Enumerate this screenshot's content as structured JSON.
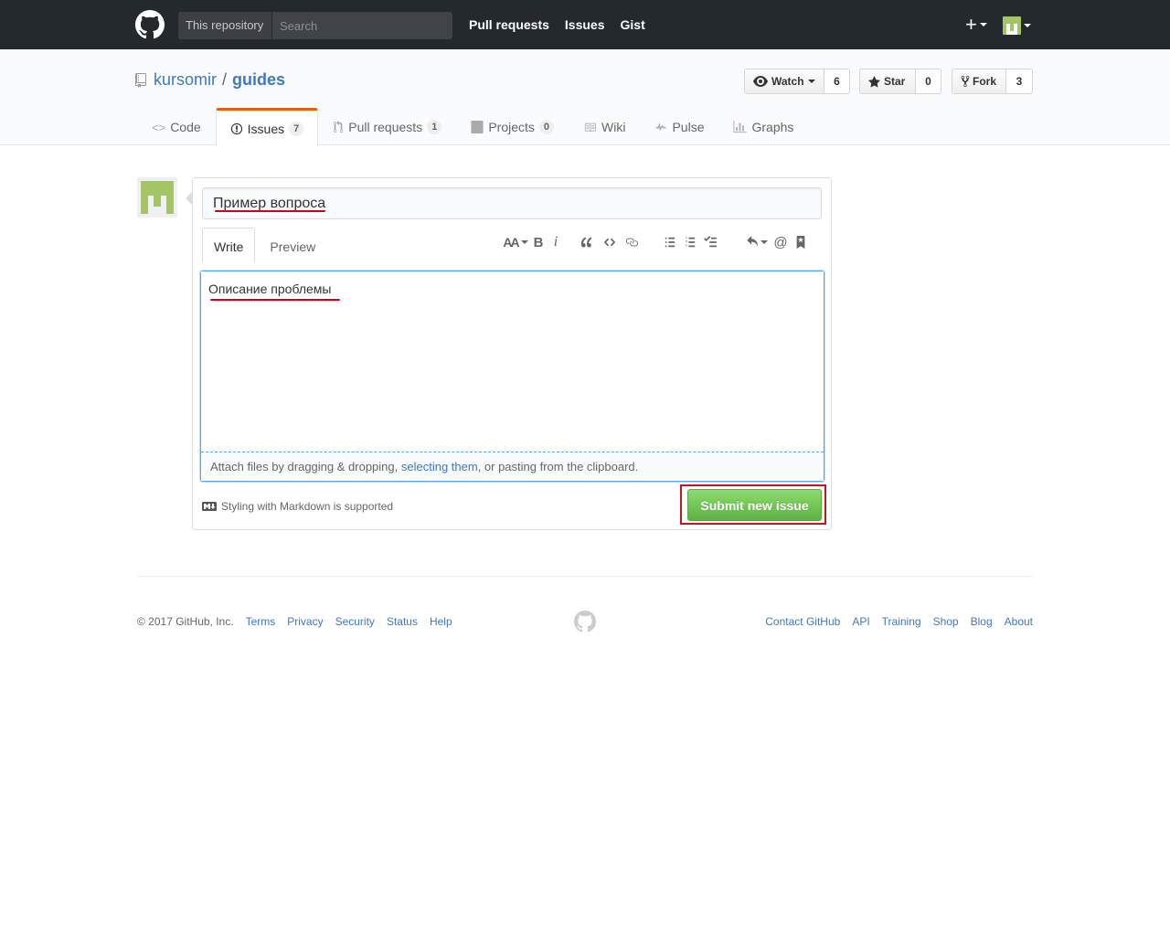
{
  "header": {
    "scope_label": "This repository",
    "search_placeholder": "Search",
    "nav": [
      "Pull requests",
      "Issues",
      "Gist"
    ],
    "plus_label": "+"
  },
  "repo": {
    "owner": "kursomir",
    "separator": "/",
    "name": "guides",
    "watch": {
      "label": "Watch",
      "count": "6"
    },
    "star": {
      "label": "Star",
      "count": "0"
    },
    "fork": {
      "label": "Fork",
      "count": "3"
    }
  },
  "reponav": {
    "code": {
      "label": "Code"
    },
    "issues": {
      "label": "Issues",
      "count": "7"
    },
    "pulls": {
      "label": "Pull requests",
      "count": "1"
    },
    "projects": {
      "label": "Projects",
      "count": "0"
    },
    "wiki": {
      "label": "Wiki"
    },
    "pulse": {
      "label": "Pulse"
    },
    "graphs": {
      "label": "Graphs"
    }
  },
  "form": {
    "title_value": "Пример вопроса",
    "write_tab": "Write",
    "preview_tab": "Preview",
    "body_value": "Описание проблемы",
    "attach_prefix": "Attach files by dragging & dropping, ",
    "attach_link": "selecting them",
    "attach_suffix": ", or pasting from the clipboard.",
    "markdown_hint": "Styling with Markdown is supported",
    "submit_label": "Submit new issue",
    "toolbar": {
      "text_size": "AA",
      "bold": "B",
      "italic": "i",
      "mention": "@"
    }
  },
  "footer": {
    "copyright": "© 2017 GitHub, Inc.",
    "left_links": [
      "Terms",
      "Privacy",
      "Security",
      "Status",
      "Help"
    ],
    "right_links": [
      "Contact GitHub",
      "API",
      "Training",
      "Shop",
      "Blog",
      "About"
    ]
  },
  "colors": {
    "header_bg": "#24292e",
    "link": "#4078c0",
    "submit_green": "#60b044",
    "highlight_red": "#c4161c",
    "selected_tab_accent": "#e36209",
    "avatar_green": "#a4c466"
  }
}
